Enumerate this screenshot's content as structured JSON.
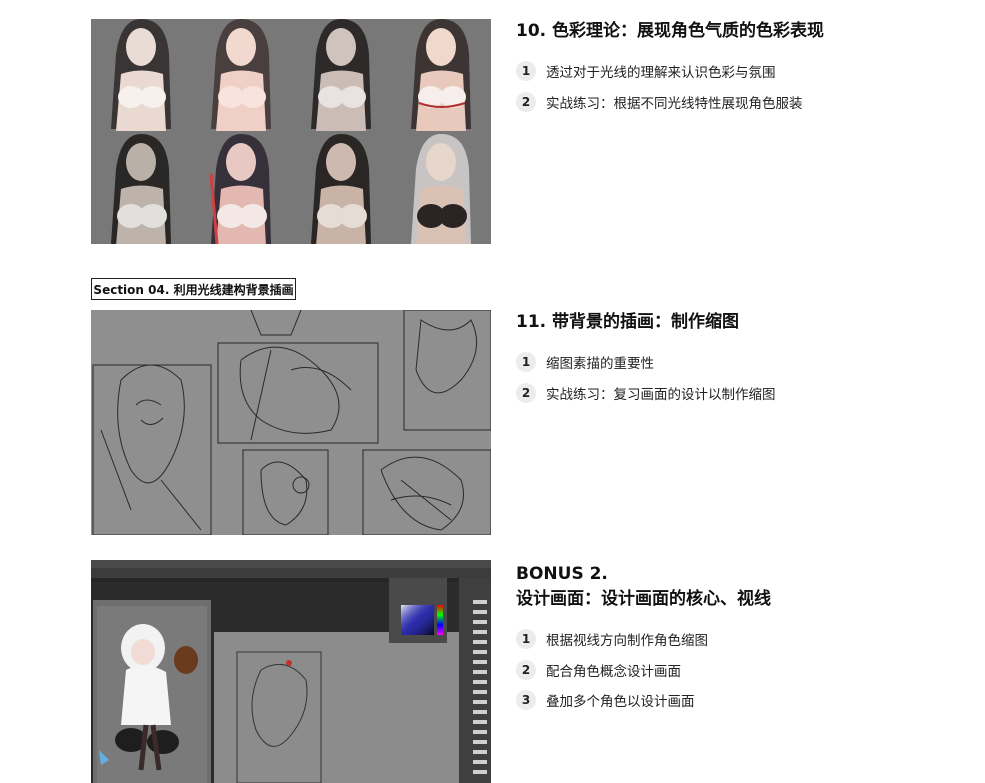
{
  "lessons": [
    {
      "title": "10. 色彩理论：展现角色气质的色彩表现",
      "items": [
        {
          "num": "1",
          "text": "透过对于光线的理解来认识色彩与氛围"
        },
        {
          "num": "2",
          "text": "实战练习：根据不同光线特性展现角色服装"
        }
      ]
    },
    {
      "title": "11. 带背景的插画：制作缩图",
      "items": [
        {
          "num": "1",
          "text": "缩图素描的重要性"
        },
        {
          "num": "2",
          "text": "实战练习：复习画面的设计以制作缩图"
        }
      ]
    },
    {
      "title_line1": "BONUS 2.",
      "title_line2": "设计画面：设计画面的核心、视线",
      "items": [
        {
          "num": "1",
          "text": "根据视线方向制作角色缩图"
        },
        {
          "num": "2",
          "text": "配合角色概念设计画面"
        },
        {
          "num": "3",
          "text": "叠加多个角色以设计画面"
        }
      ]
    }
  ],
  "section_label": "Section 04. 利用光线建构背景插画",
  "colors": {
    "panel_gray": "#7a7a7a",
    "sketch_gray": "#8e8e8e",
    "ps_dark": "#3a3a3a"
  }
}
